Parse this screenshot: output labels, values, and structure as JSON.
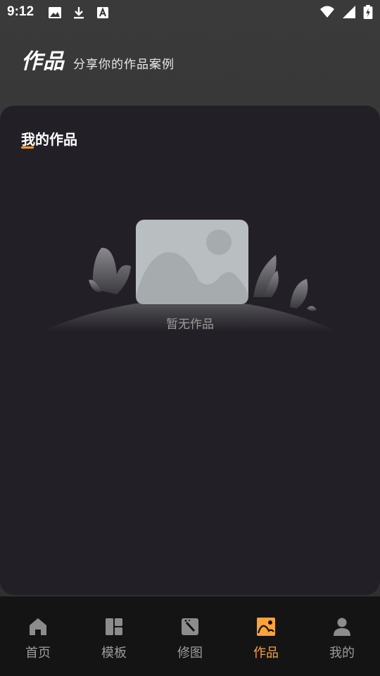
{
  "status_bar": {
    "time": "9:12",
    "left_icons": [
      "image-icon",
      "download-icon",
      "a-box-icon"
    ],
    "right_icons": [
      "wifi-icon",
      "signal-icon",
      "battery-charging-icon"
    ]
  },
  "header": {
    "title": "作品",
    "subtitle": "分享你的作品案例"
  },
  "section": {
    "title": "我的作品",
    "accent_color": "#ff9f1c"
  },
  "empty_state": {
    "text": "暂无作品",
    "icon": "empty-image-icon"
  },
  "bottom_nav": {
    "active_color": "#ffa23a",
    "items": [
      {
        "label": "首页",
        "icon": "home-icon"
      },
      {
        "label": "模板",
        "icon": "template-icon"
      },
      {
        "label": "修图",
        "icon": "magic-wand-icon"
      },
      {
        "label": "作品",
        "icon": "works-image-icon"
      },
      {
        "label": "我的",
        "icon": "user-icon"
      }
    ]
  }
}
